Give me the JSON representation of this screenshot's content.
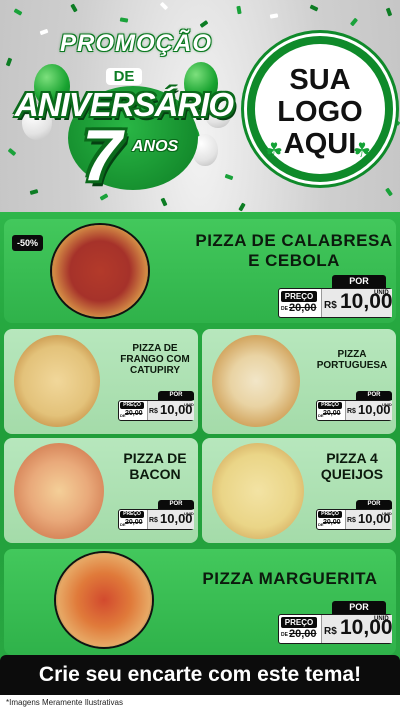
{
  "header": {
    "promo_word": "PROMOÇÃO",
    "promo_de": "DE",
    "promo_aniversario": "ANIVERSÁRIO",
    "promo_number": "7",
    "promo_anos": "ANOS",
    "logo_line1": "SUA",
    "logo_line2": "LOGO",
    "logo_line3": "AQUI"
  },
  "colors": {
    "brand_green": "#1f9d39",
    "dark_green": "#0a6a1b",
    "price_black": "#0a0a0a",
    "banner_black": "#0c0c0c"
  },
  "items": [
    {
      "name_line1": "PIZZA DE CALABRESA",
      "name_line2": "E CEBOLA",
      "badge": "-50%",
      "por": "POR",
      "preco": "PREÇO",
      "de": "DE",
      "old_price": "20,00",
      "currency": "R$",
      "price": "10,00",
      "unid": "UNID"
    },
    {
      "name_line1": "PIZZA DE",
      "name_line2": "FRANGO COM",
      "name_line3": "CATUPIRY",
      "por": "POR",
      "preco": "PREÇO",
      "de": "DE",
      "old_price": "20,00",
      "currency": "R$",
      "price": "10,00",
      "unid": "UNID"
    },
    {
      "name_line1": "PIZZA",
      "name_line2": "PORTUGUESA",
      "por": "POR",
      "preco": "PREÇO",
      "de": "DE",
      "old_price": "20,00",
      "currency": "R$",
      "price": "10,00",
      "unid": "UNID"
    },
    {
      "name_line1": "PIZZA DE",
      "name_line2": "BACON",
      "por": "POR",
      "preco": "PREÇO",
      "de": "DE",
      "old_price": "20,00",
      "currency": "R$",
      "price": "10,00",
      "unid": "UNID"
    },
    {
      "name_line1": "PIZZA 4",
      "name_line2": "QUEIJOS",
      "por": "POR",
      "preco": "PREÇO",
      "de": "DE",
      "old_price": "20,00",
      "currency": "R$",
      "price": "10,00",
      "unid": "UNID"
    },
    {
      "name_line1": "PIZZA MARGUERITA",
      "por": "POR",
      "preco": "PREÇO",
      "de": "DE",
      "old_price": "20,00",
      "currency": "R$",
      "price": "10,00",
      "unid": "UNID"
    }
  ],
  "banner": "Crie seu encarte com este tema!",
  "footnote": "*Imagens Meramente Ilustrativas",
  "icons": [
    "balloon-icon",
    "clover-icon",
    "confetti-icon"
  ]
}
